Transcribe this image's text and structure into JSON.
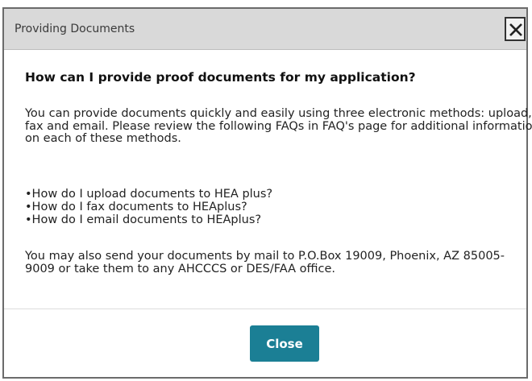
{
  "dialog": {
    "title": "Providing Documents",
    "close_icon": "close-x-icon",
    "heading": "How can I provide proof documents for my application?",
    "intro": "You can provide documents quickly and easily using three electronic methods: upload, fax and email. Please review the following FAQs in FAQ's page for additional information on each of these methods.",
    "faqs": [
      "•How do I upload documents to HEA plus?",
      "•How do I fax documents to HEAplus?",
      "•How do I email documents to HEAplus?"
    ],
    "mail_note": "You may also send your documents by mail to P.O.Box 19009, Phoenix, AZ 85005-9009 or take them to any AHCCCS or DES/FAA office.",
    "close_label": "Close"
  },
  "colors": {
    "titlebar": "#d9d9d9",
    "button": "#1b7f95",
    "button_text": "#ffffff"
  }
}
